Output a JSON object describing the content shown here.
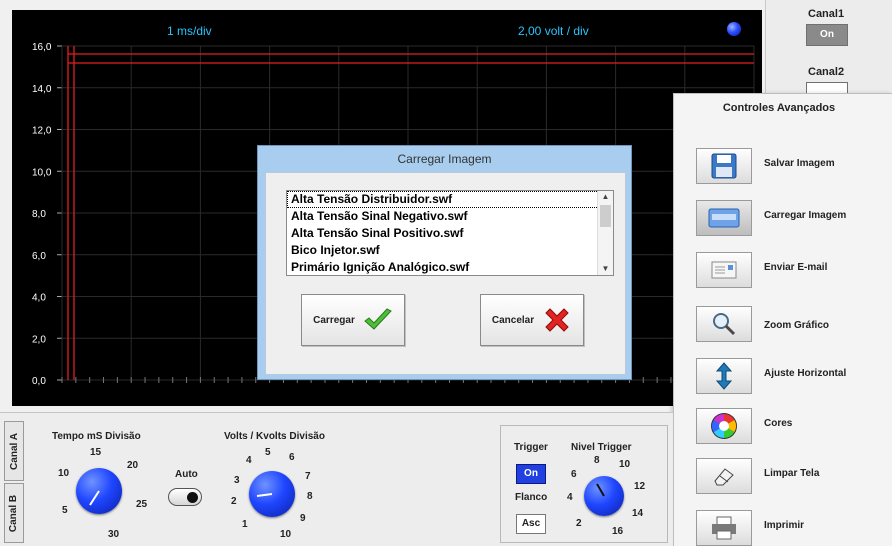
{
  "scope": {
    "time_per_div": "1 ms/div",
    "volts_per_div": "2,00 volt / div",
    "y_ticks": [
      "16,0",
      "14,0",
      "12,0",
      "10,0",
      "8,0",
      "6,0",
      "4,0",
      "2,0",
      "0,0"
    ]
  },
  "channels": {
    "canal1_label": "Canal1",
    "canal1_button": "On",
    "canal2_label": "Canal2"
  },
  "advanced": {
    "title": "Controles Avançados",
    "items": [
      {
        "label": "Salvar Imagem",
        "icon": "floppy-icon"
      },
      {
        "label": "Carregar Imagem",
        "icon": "load-image-icon"
      },
      {
        "label": "Enviar E-mail",
        "icon": "email-icon"
      },
      {
        "label": "Zoom Gráfico",
        "icon": "magnifier-icon"
      },
      {
        "label": "Ajuste Horizontal",
        "icon": "vertical-arrows-icon"
      },
      {
        "label": "Cores",
        "icon": "color-wheel-icon"
      },
      {
        "label": "Limpar Tela",
        "icon": "eraser-icon"
      },
      {
        "label": "Imprimir",
        "icon": "printer-icon"
      }
    ]
  },
  "bottom": {
    "tab_a": "Canal A",
    "tab_b": "Canal B",
    "tempo_label": "Tempo mS Divisão",
    "tempo_ticks": [
      "15",
      "20",
      "10",
      "25",
      "5",
      "30"
    ],
    "auto_label": "Auto",
    "volts_label": "Volts / Kvolts Divisão",
    "volts_ticks": [
      "5",
      "4",
      "6",
      "3",
      "7",
      "2",
      "8",
      "1",
      "9",
      "10"
    ],
    "trigger_label": "Trigger",
    "trigger_button": "On",
    "flanco_label": "Flanco",
    "flanco_button": "Asc",
    "nivel_label": "Nivel Trigger",
    "nivel_ticks": [
      "8",
      "10",
      "6",
      "12",
      "4",
      "14",
      "2",
      "16"
    ]
  },
  "dialog": {
    "title": "Carregar Imagem",
    "files": [
      "Alta Tensão Distribuidor.swf",
      "Alta Tensão Sinal Negativo.swf",
      "Alta Tensão Sinal Positivo.swf",
      "Bico Injetor.swf",
      "Primário Ignição Analógico.swf"
    ],
    "load_button": "Carregar",
    "cancel_button": "Cancelar"
  },
  "colors": {
    "scope_bg": "#000000",
    "trace": "#e02020",
    "grid": "#2a2a2a",
    "scope_text": "#28c4ff",
    "knob": "#1f46ff",
    "dialog_frame": "#a9cdee"
  }
}
